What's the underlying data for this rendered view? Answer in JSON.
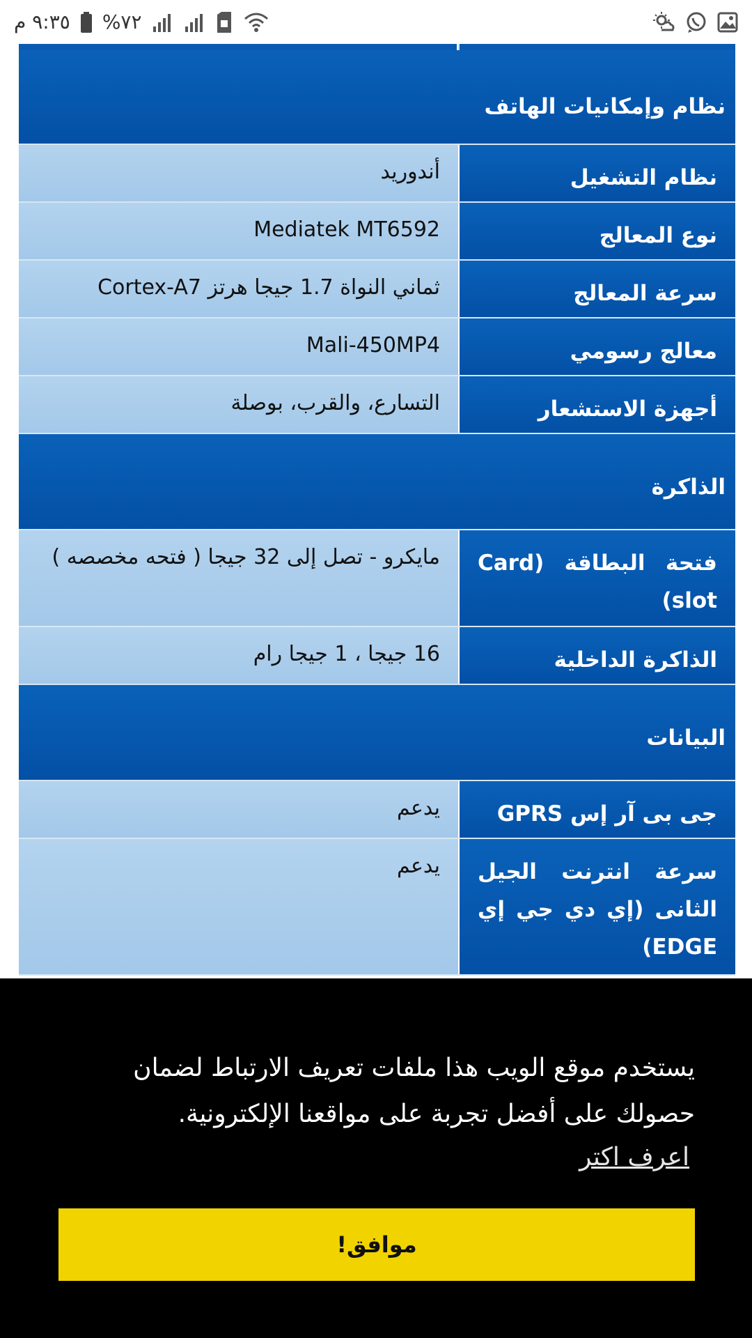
{
  "status_bar": {
    "time": "٩:٣٥ م",
    "battery": "%٧٢",
    "icons": [
      "battery-icon",
      "signal-icon",
      "signal-icon",
      "sim-icon",
      "wifi-icon",
      "weather-icon",
      "whatsapp-icon",
      "gallery-icon"
    ]
  },
  "sections": {
    "platform": "نظام وإمكانيات الهاتف",
    "memory": "الذاكرة",
    "data": "البيانات"
  },
  "platform_rows": [
    {
      "key": "نظام التشغيل",
      "value": "أندوريد"
    },
    {
      "key": "نوع المعالج",
      "value": "Mediatek MT6592"
    },
    {
      "key": "سرعة المعالج",
      "value": "ثماني النواة 1.7 جيجا هرتز Cortex-A7"
    },
    {
      "key": "معالج رسومي",
      "value": "Mali-450MP4"
    },
    {
      "key": "أجهزة الاستشعار",
      "value": "التسارع، والقرب، بوصلة"
    }
  ],
  "memory_rows": [
    {
      "key": "فتحة البطاقة (Card slot)",
      "value": "مايكرو - تصل إلى 32 جيجا ( فتحه مخصصه )"
    },
    {
      "key": "الذاكرة الداخلية",
      "value": "16 جيجا ، 1 جيجا رام"
    }
  ],
  "data_rows": [
    {
      "key": "جى بى آر إس GPRS",
      "value": "يدعم"
    },
    {
      "key": "سرعة انترنت الجيل الثانى (إي دي جي إي EDGE)",
      "value": "يدعم"
    }
  ],
  "cookie": {
    "message": "يستخدم موقع الويب هذا ملفات تعريف الارتباط لضمان حصولك على أفضل تجربة على مواقعنا الإلكترونية.",
    "learn_more": "اعرف اكتر",
    "accept": "موافق!"
  },
  "colors": {
    "header_blue": "#0a5bb0",
    "value_light_blue": "#a9cdec",
    "cookie_bg": "#000000",
    "accept_yellow": "#f1d300"
  }
}
